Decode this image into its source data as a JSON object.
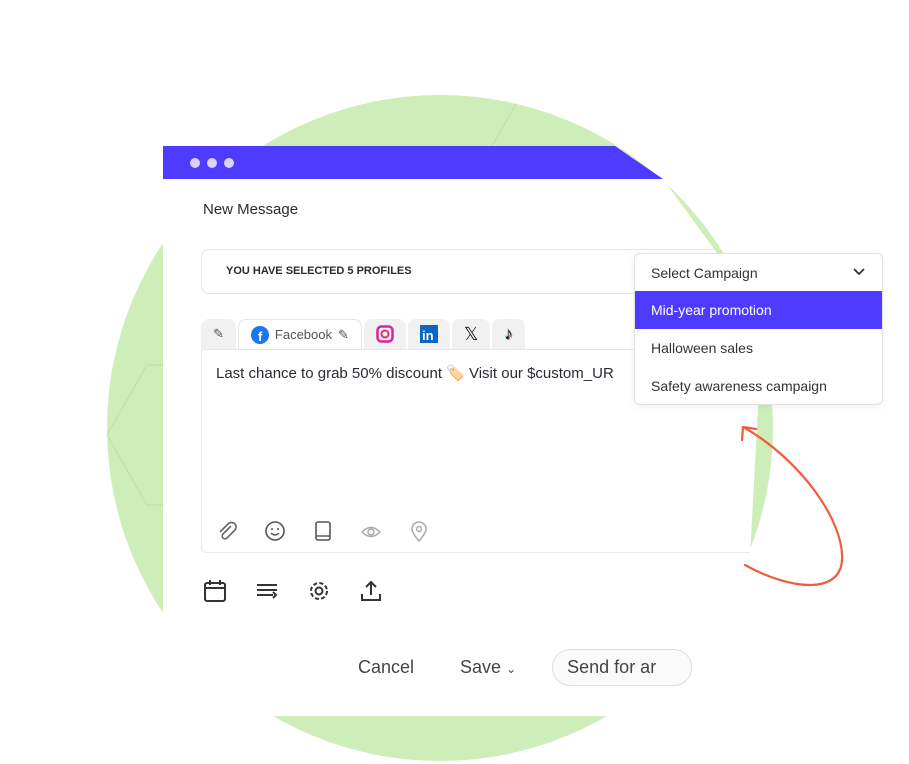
{
  "window": {
    "title": "New Message"
  },
  "profiles": {
    "label": "YOU HAVE SELECTED 5 PROFILES"
  },
  "tabs": [
    {
      "name": "edit-all",
      "label": ""
    },
    {
      "name": "facebook",
      "label": "Facebook"
    },
    {
      "name": "instagram",
      "label": ""
    },
    {
      "name": "linkedin",
      "label": ""
    },
    {
      "name": "x",
      "label": ""
    },
    {
      "name": "tiktok",
      "label": ""
    }
  ],
  "editor": {
    "message": "Last chance to grab 50% discount 🏷️ Visit our $custom_UR"
  },
  "toolbar_icons": [
    "paperclip-icon",
    "smiley-icon",
    "book-icon",
    "eye-icon",
    "location-pin-icon"
  ],
  "bottom_icons": [
    "calendar-icon",
    "reorder-icon",
    "gear-icon",
    "upload-icon"
  ],
  "actions": {
    "cancel": "Cancel",
    "save": "Save",
    "send": "Send for ar"
  },
  "campaign": {
    "placeholder": "Select Campaign",
    "options": [
      "Mid-year promotion",
      "Halloween sales",
      "Safety awareness campaign"
    ],
    "selected": "Mid-year promotion"
  },
  "colors": {
    "accent": "#4f3bff",
    "background_circle": "#cdeeb8",
    "arrow": "#f25c3e"
  }
}
